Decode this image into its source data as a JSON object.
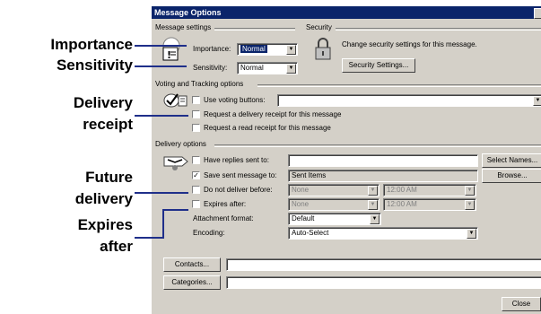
{
  "callouts": {
    "importance": "Importance",
    "sensitivity": "Sensitivity",
    "delivery_receipt_1": "Delivery",
    "delivery_receipt_2": "receipt",
    "future_delivery_1": "Future",
    "future_delivery_2": "delivery",
    "expires_after_1": "Expires",
    "expires_after_2": "after"
  },
  "dialog": {
    "title": "Message Options",
    "message_settings": {
      "group_label": "Message settings",
      "importance_label": "Importance:",
      "importance_value": "Normal",
      "sensitivity_label": "Sensitivity:",
      "sensitivity_value": "Normal"
    },
    "security": {
      "group_label": "Security",
      "description": "Change security settings for this message.",
      "settings_button": "Security Settings..."
    },
    "voting": {
      "group_label": "Voting and Tracking options",
      "use_voting_buttons": "Use voting buttons:",
      "use_voting_buttons_checked": false,
      "voting_value": "",
      "delivery_receipt": "Request a delivery receipt for this message",
      "read_receipt": "Request a read receipt for this message"
    },
    "delivery": {
      "group_label": "Delivery options",
      "have_replies_label": "Have replies sent to:",
      "have_replies_value": "",
      "select_names_button": "Select Names...",
      "save_sent_label": "Save sent message to:",
      "save_sent_checked": true,
      "save_sent_value": "Sent Items",
      "browse_button": "Browse...",
      "do_not_deliver_label": "Do not deliver before:",
      "do_not_deliver_date": "None",
      "do_not_deliver_time": "12:00 AM",
      "expires_label": "Expires after:",
      "expires_date": "None",
      "expires_time": "12:00 AM",
      "attachment_format_label": "Attachment format:",
      "attachment_format_value": "Default",
      "encoding_label": "Encoding:",
      "encoding_value": "Auto-Select"
    },
    "contacts_button": "Contacts...",
    "contacts_value": "",
    "categories_button": "Categories...",
    "categories_value": "",
    "close_button": "Close"
  }
}
